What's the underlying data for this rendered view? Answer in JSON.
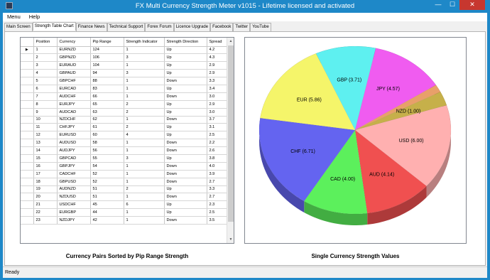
{
  "window": {
    "title": "FX Multi Currency Strength Meter v1015 - Lifetime licensed and activated",
    "minimize": "—",
    "maximize": "☐",
    "close": "✕"
  },
  "menu": [
    {
      "label": "Menu"
    },
    {
      "label": "Help"
    }
  ],
  "tabs": [
    {
      "label": "Main Screen"
    },
    {
      "label": "Strength Table Chart",
      "active": true
    },
    {
      "label": "Finance News"
    },
    {
      "label": "Technical Support"
    },
    {
      "label": "Forex Forum"
    },
    {
      "label": "Licence Upgrade"
    },
    {
      "label": "Facebook"
    },
    {
      "label": "Twitter"
    },
    {
      "label": "YouTube"
    }
  ],
  "table": {
    "columns": [
      "Position",
      "Currency",
      "Pip Range",
      "Strength Indicator",
      "Strength Direction",
      "Spread"
    ],
    "current_row_marker": "▶",
    "rows": [
      [
        "1",
        "EURNZD",
        "124",
        "1",
        "Up",
        "4.2"
      ],
      [
        "2",
        "GBPNZD",
        "106",
        "3",
        "Up",
        "4.3"
      ],
      [
        "3",
        "EURAUD",
        "104",
        "1",
        "Up",
        "2.9"
      ],
      [
        "4",
        "GBPAUD",
        "94",
        "3",
        "Up",
        "2.9"
      ],
      [
        "5",
        "GBPCHF",
        "88",
        "1",
        "Down",
        "3.3"
      ],
      [
        "6",
        "EURCAD",
        "83",
        "1",
        "Up",
        "3.4"
      ],
      [
        "7",
        "AUDCHF",
        "66",
        "1",
        "Down",
        "3.0"
      ],
      [
        "8",
        "EURJPY",
        "65",
        "2",
        "Up",
        "2.9"
      ],
      [
        "9",
        "AUDCAD",
        "63",
        "2",
        "Up",
        "3.0"
      ],
      [
        "10",
        "NZDCHF",
        "62",
        "1",
        "Down",
        "3.7"
      ],
      [
        "11",
        "CHFJPY",
        "61",
        "2",
        "Up",
        "3.1"
      ],
      [
        "12",
        "EURUSD",
        "60",
        "4",
        "Up",
        "2.5"
      ],
      [
        "13",
        "AUDUSD",
        "58",
        "1",
        "Down",
        "2.2"
      ],
      [
        "14",
        "AUDJPY",
        "56",
        "1",
        "Down",
        "2.6"
      ],
      [
        "15",
        "GBPCAD",
        "55",
        "3",
        "Up",
        "3.8"
      ],
      [
        "16",
        "GBPJPY",
        "54",
        "1",
        "Down",
        "4.0"
      ],
      [
        "17",
        "CADCHF",
        "52",
        "1",
        "Down",
        "3.9"
      ],
      [
        "18",
        "GBPUSD",
        "52",
        "1",
        "Down",
        "2.7"
      ],
      [
        "19",
        "AUDNZD",
        "51",
        "2",
        "Up",
        "3.3"
      ],
      [
        "20",
        "NZDUSD",
        "51",
        "1",
        "Down",
        "2.7"
      ],
      [
        "21",
        "USDCHF",
        "45",
        "6",
        "Up",
        "2.3"
      ],
      [
        "22",
        "EURGBP",
        "44",
        "1",
        "Up",
        "2.5"
      ],
      [
        "23",
        "NZDJPY",
        "42",
        "1",
        "Down",
        "3.5"
      ]
    ]
  },
  "captions": {
    "left": "Currency Pairs Sorted by Pip Range Strength",
    "right": "Single Currency Strength Values"
  },
  "status": "Ready",
  "scroll": {
    "up": "▲",
    "down": "▼"
  },
  "chart_data": {
    "type": "pie",
    "slices": [
      {
        "label": "GBP (3.71)",
        "name": "GBP",
        "value": 3.71,
        "color": "#5ef0f0"
      },
      {
        "label": "JPY (4.57)",
        "name": "JPY",
        "value": 4.57,
        "color": "#f05cf0"
      },
      {
        "label": "",
        "name": "",
        "value": 0.55,
        "color": "#e8a06a"
      },
      {
        "label": "NZD (1.00)",
        "name": "NZD",
        "value": 1.0,
        "color": "#c6b04a"
      },
      {
        "label": "USD (6.00)",
        "name": "USD",
        "value": 6.0,
        "color": "#ffb0b0"
      },
      {
        "label": "AUD (4.14)",
        "name": "AUD",
        "value": 4.14,
        "color": "#f05050"
      },
      {
        "label": "CAD (4.00)",
        "name": "CAD",
        "value": 4.0,
        "color": "#5cf05c"
      },
      {
        "label": "CHF (6.71)",
        "name": "CHF",
        "value": 6.71,
        "color": "#6464f0"
      },
      {
        "label": "EUR (5.86)",
        "name": "EUR",
        "value": 5.86,
        "color": "#f5f56a"
      }
    ]
  }
}
